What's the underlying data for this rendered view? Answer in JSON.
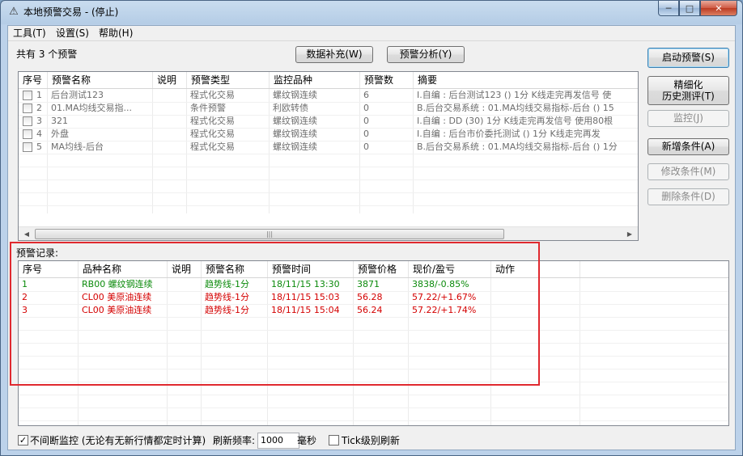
{
  "window": {
    "title": "本地预警交易 - (停止)",
    "icon": "warning-triangle-icon",
    "controls": {
      "minimize": "─",
      "maximize": "□",
      "close": "✕"
    }
  },
  "menu": [
    "工具(T)",
    "设置(S)",
    "帮助(H)"
  ],
  "toolbar": {
    "count_text": "共有 3 个预警",
    "data_fill": "数据补充(W)",
    "analysis": "预警分析(Y)"
  },
  "side_buttons": {
    "start": "启动预警(S)",
    "refine_line1": "精细化",
    "refine_line2": "历史测评(T)",
    "monitor": "监控(J)",
    "add": "新增条件(A)",
    "edit": "修改条件(M)",
    "delete": "删除条件(D)"
  },
  "alerts_table": {
    "columns": [
      "序号",
      "预警名称",
      "说明",
      "预警类型",
      "监控品种",
      "预警数",
      "摘要"
    ],
    "rows": [
      {
        "no": "1",
        "name": "后台测试123",
        "desc": "",
        "type": "程式化交易",
        "product": "螺纹钢连续",
        "count": "6",
        "summary": "I.自编 : 后台测试123 () 1分 K线走完再发信号 使"
      },
      {
        "no": "2",
        "name": "01.MA均线交易指...",
        "desc": "",
        "type": "条件预警",
        "product": "利欧转债",
        "count": "0",
        "summary": "B.后台交易系统 : 01.MA均线交易指标-后台 () 15"
      },
      {
        "no": "3",
        "name": "321",
        "desc": "",
        "type": "程式化交易",
        "product": "螺纹钢连续",
        "count": "0",
        "summary": "I.自编 : DD (30) 1分 K线走完再发信号 使用80根"
      },
      {
        "no": "4",
        "name": "外盘",
        "desc": "",
        "type": "程式化交易",
        "product": "螺纹钢连续",
        "count": "0",
        "summary": "I.自编 : 后台市价委托测试 () 1分 K线走完再发"
      },
      {
        "no": "5",
        "name": "MA均线-后台",
        "desc": "",
        "type": "程式化交易",
        "product": "螺纹钢连续",
        "count": "0",
        "summary": "B.后台交易系统 : 01.MA均线交易指标-后台 () 1分"
      }
    ]
  },
  "records_label": "预警记录:",
  "records_table": {
    "columns": [
      "序号",
      "品种名称",
      "说明",
      "预警名称",
      "预警时间",
      "预警价格",
      "现价/盈亏",
      "动作"
    ],
    "rows": [
      {
        "no": "1",
        "product": "RB00 螺纹钢连续",
        "desc": "",
        "alert": "趋势线-1分",
        "time": "18/11/15 13:30",
        "price": "3871",
        "pnl": "3838/-0.85%",
        "action": "",
        "color": "#0b8a0b"
      },
      {
        "no": "2",
        "product": "CL00 美原油连续",
        "desc": "",
        "alert": "趋势线-1分",
        "time": "18/11/15 15:03",
        "price": "56.28",
        "pnl": "57.22/+1.67%",
        "action": "",
        "color": "#d40000"
      },
      {
        "no": "3",
        "product": "CL00 美原油连续",
        "desc": "",
        "alert": "趋势线-1分",
        "time": "18/11/15 15:04",
        "price": "56.24",
        "pnl": "57.22/+1.74%",
        "action": "",
        "color": "#d40000"
      }
    ]
  },
  "status": {
    "continuous_monitor": "不间断监控 (无论有无新行情都定时计算)",
    "continuous_checked": true,
    "refresh_label": "刷新频率:",
    "refresh_value": "1000",
    "unit": "毫秒",
    "tick_label": "Tick级别刷新",
    "tick_checked": false
  }
}
